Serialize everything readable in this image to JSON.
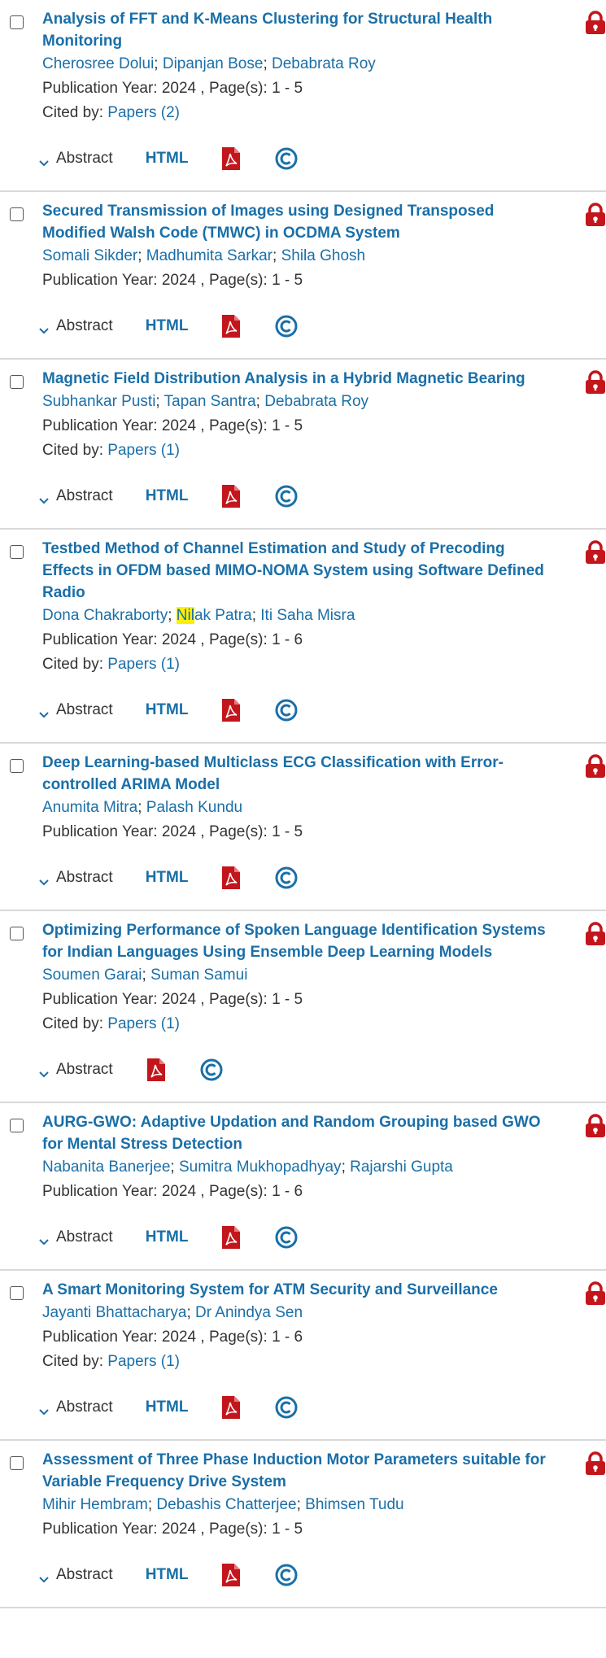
{
  "actions": {
    "abstract_label": "Abstract",
    "html_label": "HTML",
    "pdf_icon": "pdf-icon",
    "copyright_icon": "copyright-icon",
    "lock_icon": "lock-icon"
  },
  "labels": {
    "publication_year": "Publication Year:",
    "pages": ", Page(s):",
    "cited_by": "Cited by:"
  },
  "colors": {
    "link": "#1a6fa8",
    "lock": "#c3161c",
    "pdf": "#c3161c",
    "highlight": "#ffef00"
  },
  "results": [
    {
      "title": "Analysis of FFT and K-Means Clustering for Structural Health Monitoring",
      "authors": [
        "Cherosree Dolui",
        "Dipanjan Bose",
        "Debabrata Roy"
      ],
      "year": "2024",
      "pages": "1  -  5",
      "cited": "Papers (2)",
      "html": true
    },
    {
      "title": "Secured Transmission of Images using Designed Transposed Modified Walsh Code (TMWC) in OCDMA System",
      "authors": [
        "Somali Sikder",
        "Madhumita Sarkar",
        "Shila Ghosh"
      ],
      "year": "2024",
      "pages": "1  -  5",
      "cited": null,
      "html": true
    },
    {
      "title": "Magnetic Field Distribution Analysis in a Hybrid Magnetic Bearing",
      "authors": [
        "Subhankar Pusti",
        "Tapan Santra",
        "Debabrata Roy"
      ],
      "year": "2024",
      "pages": "1  -  5",
      "cited": "Papers (1)",
      "html": true
    },
    {
      "title": "Testbed Method of Channel Estimation and Study of Precoding Effects in OFDM based MIMO-NOMA System using Software Defined Radio",
      "authors": [
        "Dona Chakraborty",
        "Nilak Patra",
        "Iti Saha Misra"
      ],
      "highlight": {
        "author": 1,
        "text": "Nil"
      },
      "year": "2024",
      "pages": "1  -  6",
      "cited": "Papers (1)",
      "html": true
    },
    {
      "title": "Deep Learning-based Multiclass ECG Classification with Error-controlled ARIMA Model",
      "authors": [
        "Anumita Mitra",
        "Palash Kundu"
      ],
      "year": "2024",
      "pages": "1  -  5",
      "cited": null,
      "html": true
    },
    {
      "title": "Optimizing Performance of Spoken Language Identification Systems for Indian Languages Using Ensemble Deep Learning Models",
      "authors": [
        "Soumen Garai",
        "Suman Samui"
      ],
      "year": "2024",
      "pages": "1  -  5",
      "cited": "Papers (1)",
      "html": false
    },
    {
      "title": "AURG-GWO: Adaptive Updation and Random Grouping based GWO for Mental Stress Detection",
      "authors": [
        "Nabanita Banerjee",
        "Sumitra Mukhopadhyay",
        "Rajarshi Gupta"
      ],
      "year": "2024",
      "pages": "1  -  6",
      "cited": null,
      "html": true
    },
    {
      "title": "A Smart Monitoring System for ATM Security and Surveillance",
      "authors": [
        "Jayanti Bhattacharya",
        "Dr Anindya Sen"
      ],
      "year": "2024",
      "pages": "1  -  6",
      "cited": "Papers (1)",
      "html": true
    },
    {
      "title": "Assessment of Three Phase Induction Motor Parameters suitable for Variable Frequency Drive System",
      "authors": [
        "Mihir Hembram",
        "Debashis Chatterjee",
        "Bhimsen Tudu"
      ],
      "year": "2024",
      "pages": "1  -  5",
      "cited": null,
      "html": true
    }
  ]
}
